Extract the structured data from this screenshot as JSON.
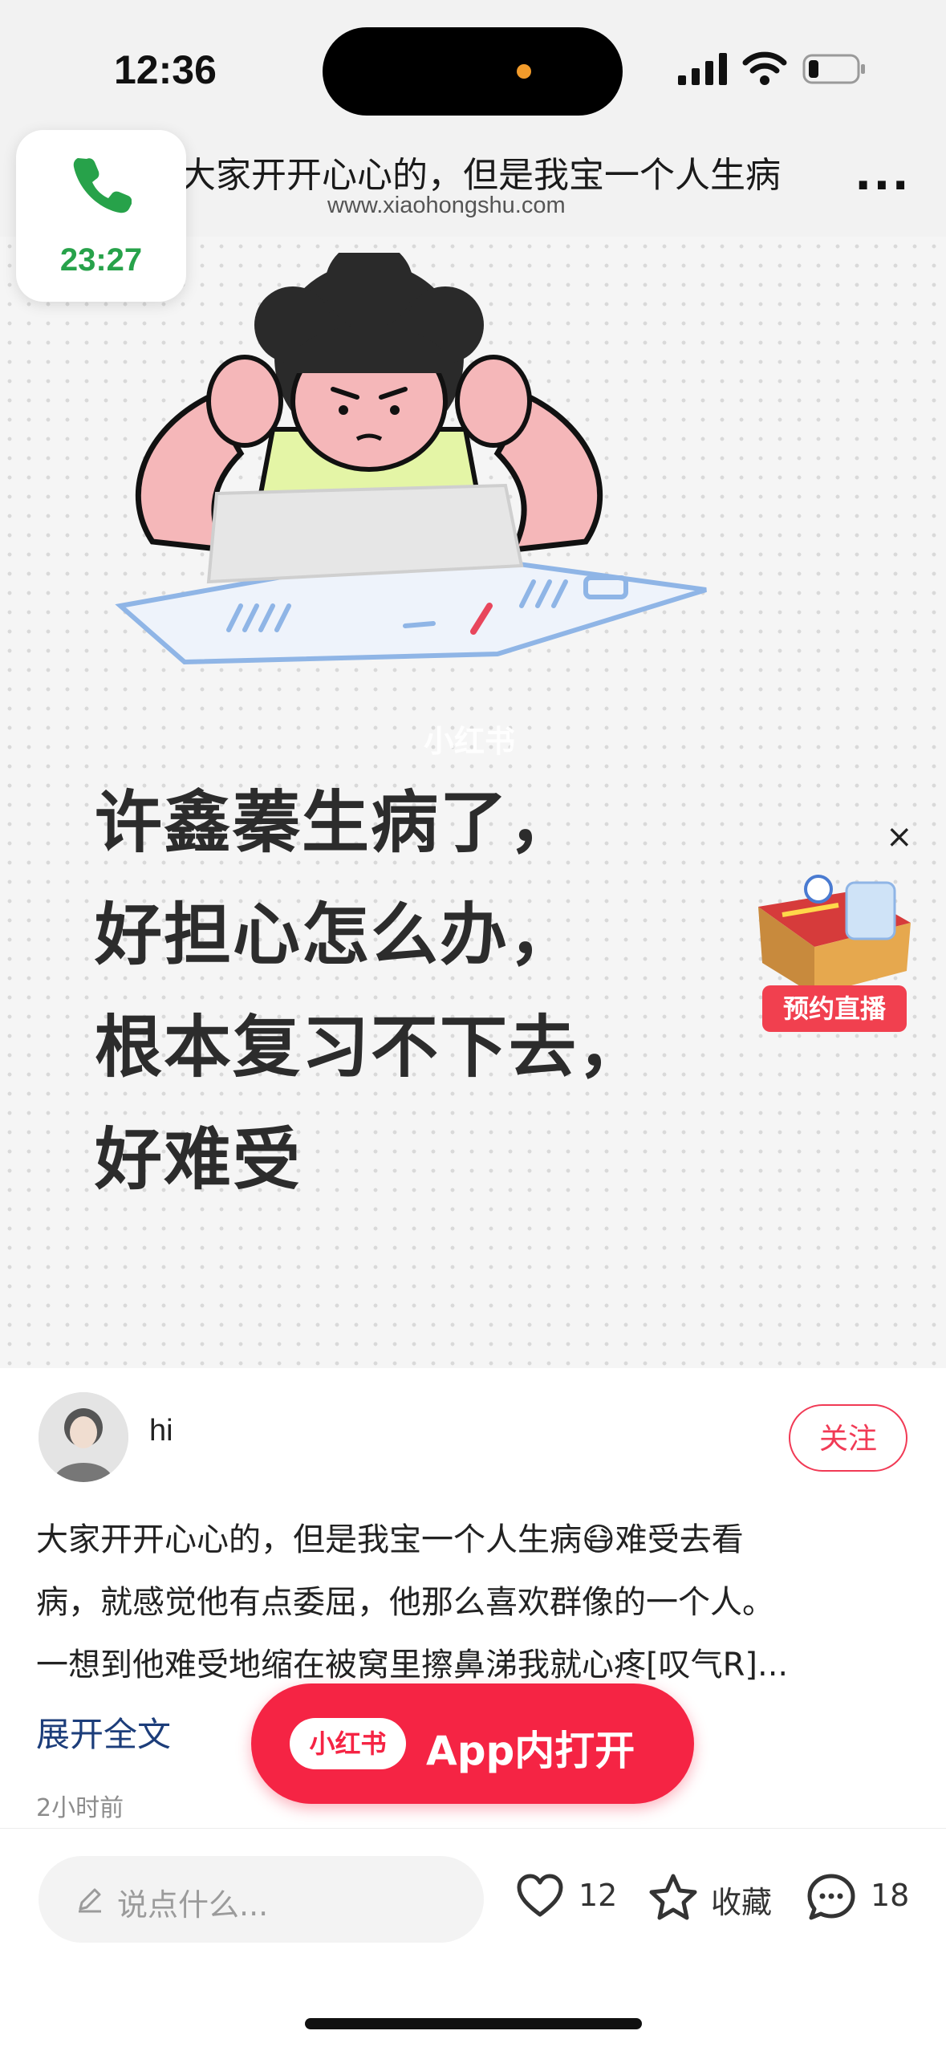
{
  "status_bar": {
    "time": "12:36"
  },
  "browser": {
    "page_title": "大家开开心心的，但是我宝一个人生病",
    "url": "www.xiaohongshu.com",
    "more": "..."
  },
  "call_pill": {
    "duration": "23:27"
  },
  "hero": {
    "watermark": "小红书",
    "lines": [
      "许鑫蓁生病了，",
      "好担心怎么办，",
      "根本复习不下去，",
      "好难受"
    ],
    "highlight": "许鑫蓁",
    "line1_rest": "生病了，"
  },
  "live_ad": {
    "badge": "预约直播",
    "close": "×"
  },
  "post": {
    "author": "hi",
    "follow_label": "关注",
    "body_lines": [
      "大家开开心心的，但是我宝一个人生病😷难受去看",
      "病，就感觉他有点委屈，他那么喜欢群像的一个人。",
      "一想到他难受地缩在被窝里擦鼻涕我就心疼[叹气R]..."
    ],
    "expand_label": "展开全文",
    "time_ago": "2小时前"
  },
  "open_app": {
    "logo": "小红书",
    "label": "App内打开"
  },
  "bottom_bar": {
    "comment_placeholder": "说点什么...",
    "likes": "12",
    "collect_label": "收藏",
    "comments": "18"
  },
  "colors": {
    "brand_red": "#f52444",
    "call_green": "#27a24a",
    "link_blue": "#1c3d7a"
  }
}
